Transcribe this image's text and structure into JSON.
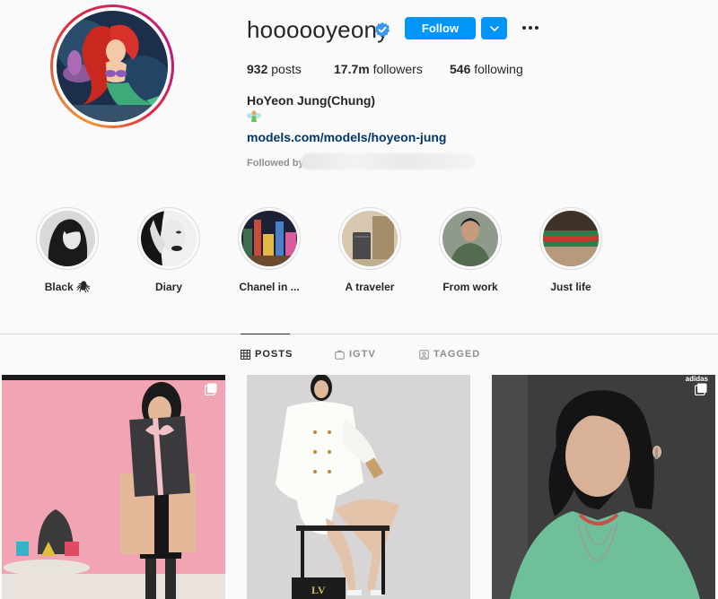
{
  "profile": {
    "username": "hoooooyeony",
    "follow_label": "Follow",
    "full_name": "HoYeon Jung(Chung)",
    "link": "models.com/models/hoyeon-jung",
    "followed_by_label": "Followed by"
  },
  "stats": {
    "posts_count": "932",
    "posts_label": " posts",
    "followers_count": "17.7m",
    "followers_label": " followers",
    "following_count": "546",
    "following_label": " following"
  },
  "highlights": [
    {
      "label": "Black 🕷"
    },
    {
      "label": "Diary"
    },
    {
      "label": "Chanel in ..."
    },
    {
      "label": "A traveler"
    },
    {
      "label": "From work"
    },
    {
      "label": "Just life"
    }
  ],
  "tabs": [
    {
      "label": "POSTS",
      "icon": "grid-icon",
      "active": true
    },
    {
      "label": "IGTV",
      "icon": "igtv-icon",
      "active": false
    },
    {
      "label": "TAGGED",
      "icon": "tagged-icon",
      "active": false
    }
  ],
  "posts": [
    {
      "icon": "multiple-posts-icon"
    },
    {
      "icon": ""
    },
    {
      "icon": "multiple-posts-icon",
      "watermark": "adidas"
    }
  ],
  "colors": {
    "accent": "#0095f6",
    "link": "#00376b",
    "text": "#262626",
    "muted": "#8e8e8e",
    "background": "#fafafa"
  }
}
